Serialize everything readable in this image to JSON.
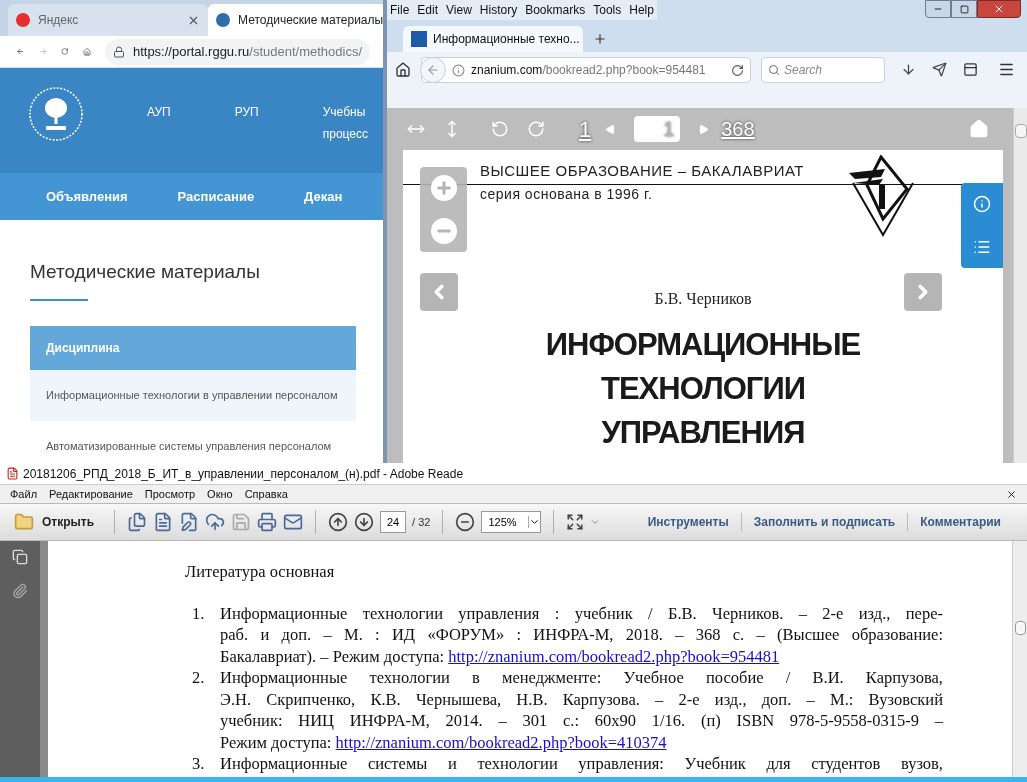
{
  "chrome": {
    "tabs": [
      {
        "title": "Яндекс",
        "selected": false
      },
      {
        "title": "Методические материалы",
        "selected": true
      }
    ],
    "url_host": "https://portal.rggu.ru",
    "url_path": "/student/methodics/",
    "top_nav": [
      {
        "lines": [
          "АУП"
        ]
      },
      {
        "lines": [
          "РУП"
        ]
      },
      {
        "lines": [
          "Учебны",
          "процесс"
        ]
      }
    ],
    "main_nav": [
      "Объявления",
      "Расписание",
      "Декан"
    ],
    "heading": "Методические материалы",
    "table": {
      "column": "Дисциплина",
      "rows": [
        "Информационные технологии в управлении персоналом",
        "Автоматизированные системы управления персоналом"
      ]
    }
  },
  "firefox": {
    "menu": [
      "File",
      "Edit",
      "View",
      "History",
      "Bookmarks",
      "Tools",
      "Help"
    ],
    "tab": {
      "title": "Информационные техно..."
    },
    "url_host": "znanium.com",
    "url_path": "/bookread2.php?book=954481",
    "search_placeholder": "Search",
    "reader": {
      "first_page": "1",
      "current_page": "1",
      "last_page": "368"
    },
    "book": {
      "series": "ВЫСШЕЕ ОБРАЗОВАНИЕ – БАКАЛАВРИАТ",
      "series_note": "серия основана в 1996 г.",
      "author": "Б.В. Черников",
      "title_lines": [
        "ИНФОРМАЦИОННЫЕ",
        "ТЕХНОЛОГИИ",
        "УПРАВЛЕНИЯ"
      ]
    }
  },
  "adobe": {
    "title": "20181206_РПД_2018_Б_ИТ_в_управлении_персоналом_(н).pdf - Adobe Reade",
    "menu": [
      "Файл",
      "Редактирование",
      "Просмотр",
      "Окно",
      "Справка"
    ],
    "open_button": "Открыть",
    "page_input": "24",
    "page_total": "/ 32",
    "zoom": "125%",
    "panels": [
      "Инструменты",
      "Заполнить и подписать",
      "Комментарии"
    ],
    "doc": {
      "heading": "Литература основная",
      "items": [
        {
          "number": "1.",
          "lines": [
            "Информационные технологии управления : учебник / Б.В. Черников. – 2-е изд., пере-",
            "раб. и доп. – М. : ИД «ФОРУМ» : ИНФРА-М, 2018. – 368 с. – (Высшее образование:",
            "Бакалавриат). – Режим доступа:"
          ],
          "link": "http://znanium.com/bookread2.php?book=954481"
        },
        {
          "number": "2.",
          "lines": [
            "Информационные технологии в менеджменте: Учебное пособие / В.И. Карпузова,",
            "Э.Н. Скрипченко, К.В. Чернышева, Н.В. Карпузова. – 2-е изд., доп. – М.: Вузовский",
            "учебник: НИЦ ИНФРА-М, 2014. – 301 с.: 60x90 1/16. (п) ISBN 978-5-9558-0315-9 –",
            "Режим доступа:"
          ],
          "link": "http://znanium.com/bookread2.php?book=410374"
        },
        {
          "number": "3.",
          "lines": [
            "Информационные системы и технологии управления: Учебник для студентов вузов,"
          ]
        }
      ]
    }
  }
}
